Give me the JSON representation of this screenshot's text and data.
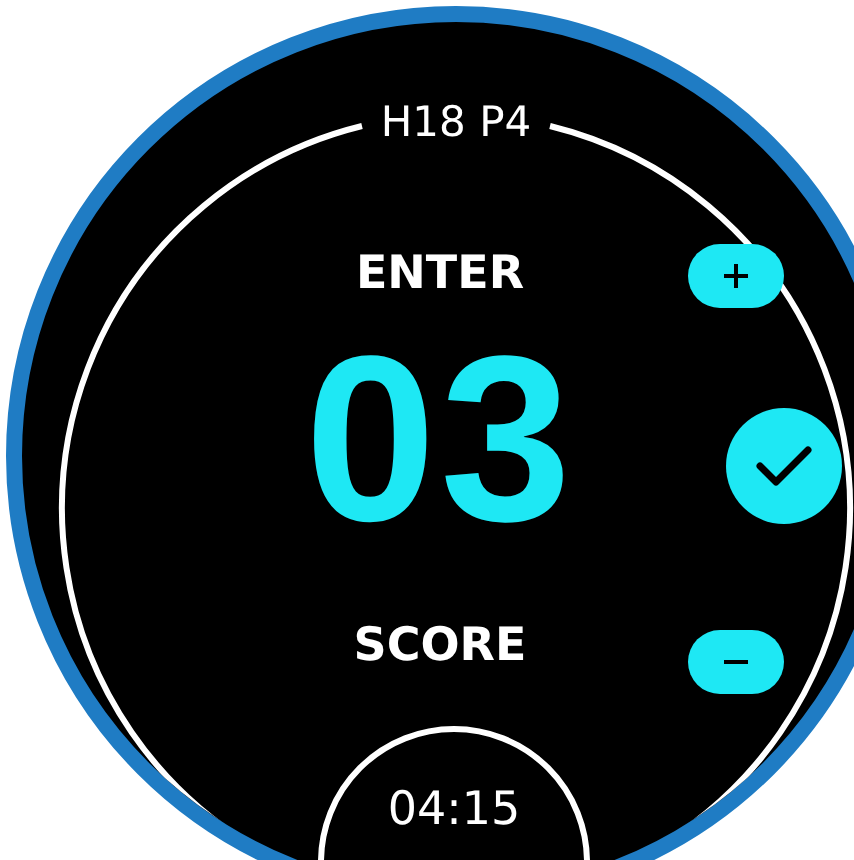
{
  "header": {
    "title": "H18 P4"
  },
  "entry": {
    "prompt": "ENTER",
    "value": "03",
    "label": "SCORE"
  },
  "controls": [
    {
      "kind": "plus"
    },
    {
      "kind": "confirm"
    },
    {
      "kind": "minus"
    }
  ],
  "footer": {
    "time": "04:15"
  }
}
